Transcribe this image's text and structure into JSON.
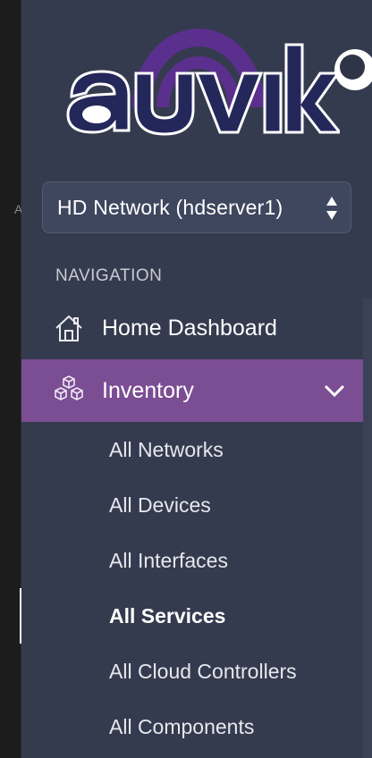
{
  "app": {
    "brand": "auvik",
    "colors": {
      "sidebar_bg": "#353b4e",
      "active_bg": "#7b4d93",
      "logo_purple": "#5b2f8d",
      "logo_navy": "#24275a"
    }
  },
  "left_strip": {
    "fragment": "A"
  },
  "network_selector": {
    "value": "HD Network (hdserver1)",
    "icon": "up-down-arrows-icon"
  },
  "navigation": {
    "heading": "NAVIGATION",
    "items": [
      {
        "label": "Home Dashboard",
        "icon": "home-icon",
        "active": false
      },
      {
        "label": "Inventory",
        "icon": "cubes-icon",
        "active": true,
        "expanded": true
      }
    ],
    "inventory_subitems": [
      {
        "label": "All Networks"
      },
      {
        "label": "All Devices"
      },
      {
        "label": "All Interfaces"
      },
      {
        "label": "All Services",
        "selected": true
      },
      {
        "label": "All Cloud Controllers"
      },
      {
        "label": "All Components"
      }
    ]
  }
}
